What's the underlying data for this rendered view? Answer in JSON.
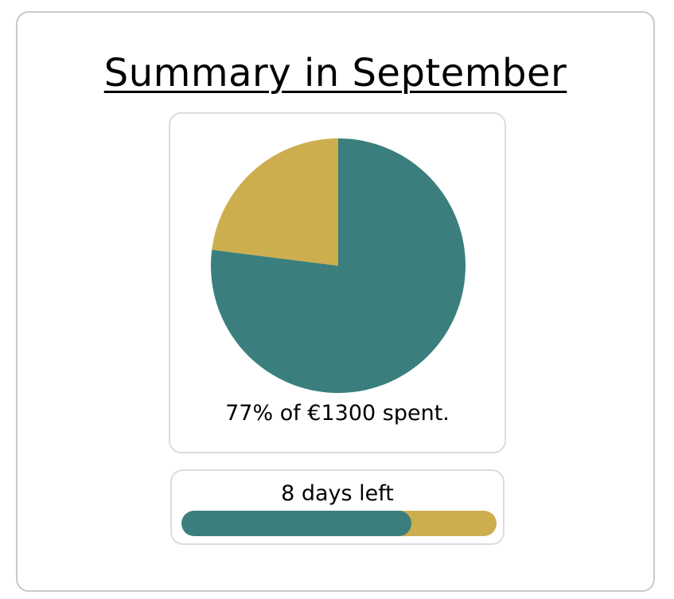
{
  "summary": {
    "title": "Summary in September",
    "spent_caption": "77% of €1300 spent.",
    "days_left_label": "8 days left"
  },
  "chart_data": {
    "type": "pie",
    "slices": [
      {
        "value": 77,
        "color": "#3a7f7d"
      },
      {
        "value": 23,
        "color": "#cdae4f"
      }
    ]
  },
  "days_progress": {
    "fraction_elapsed": 0.73,
    "fill_color": "#3a7f7d",
    "track_color": "#cdae4f"
  }
}
